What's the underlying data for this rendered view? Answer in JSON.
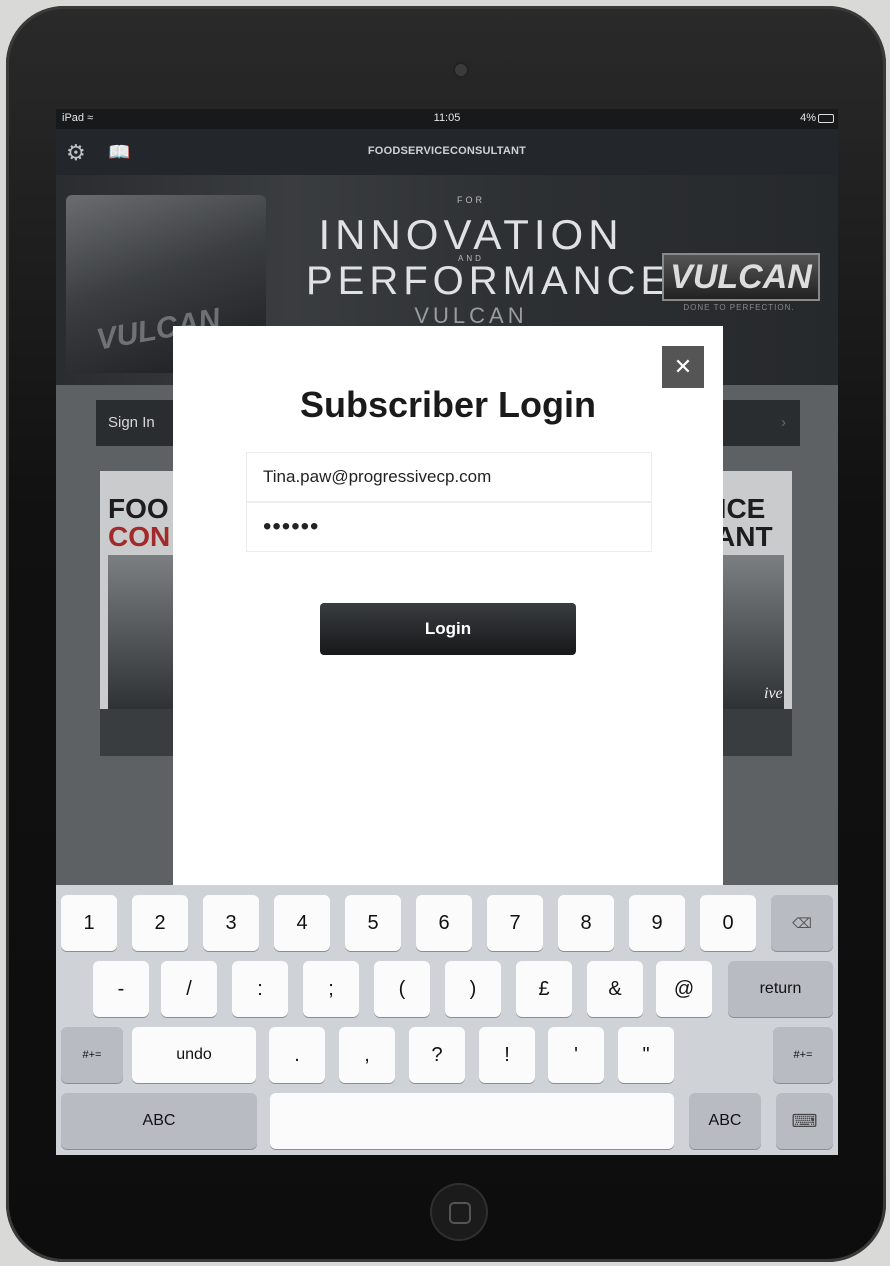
{
  "status_bar": {
    "device": "iPad",
    "wifi_icon": "wifi-icon",
    "time": "11:05",
    "battery": "4%"
  },
  "nav": {
    "title": "FOODSERVICECONSULTANT",
    "left_icons": [
      "gear-icon",
      "book-icon"
    ]
  },
  "banner": {
    "line_for": "FOR",
    "line_innovation": "INNOVATION",
    "line_and": "AND",
    "line_performance": "PERFORMANCE",
    "line_brand": "VULCAN",
    "logo_text": "VULCAN",
    "logo_sub": "DONE TO PERFECTION.",
    "grill_logo": "VULCAN"
  },
  "background": {
    "sign_in": "Sign In",
    "cover_left": {
      "line1": "FOO",
      "line2": "CON"
    },
    "cover_right": {
      "line1": "VICE",
      "line2": "TANT",
      "caption": "ive"
    }
  },
  "modal": {
    "title": "Subscriber Login",
    "email_value": "Tina.paw@progressivecp.com",
    "password_value": "••••••",
    "login_label": "Login",
    "close_label": "✕"
  },
  "keyboard": {
    "row1": [
      "1",
      "2",
      "3",
      "4",
      "5",
      "6",
      "7",
      "8",
      "9",
      "0"
    ],
    "backspace_icon": "backspace-icon",
    "row2": [
      "-",
      "/",
      ":",
      ";",
      "(",
      ")",
      "£",
      "&",
      "@"
    ],
    "return_label": "return",
    "row3_left": "#+=",
    "undo_label": "undo",
    "row3": [
      ".",
      ",",
      "?",
      "!",
      "'",
      "\""
    ],
    "row3_right": "#+=",
    "abc_left": "ABC",
    "abc_right": "ABC",
    "hide_keyboard_icon": "keyboard-hide-icon"
  }
}
